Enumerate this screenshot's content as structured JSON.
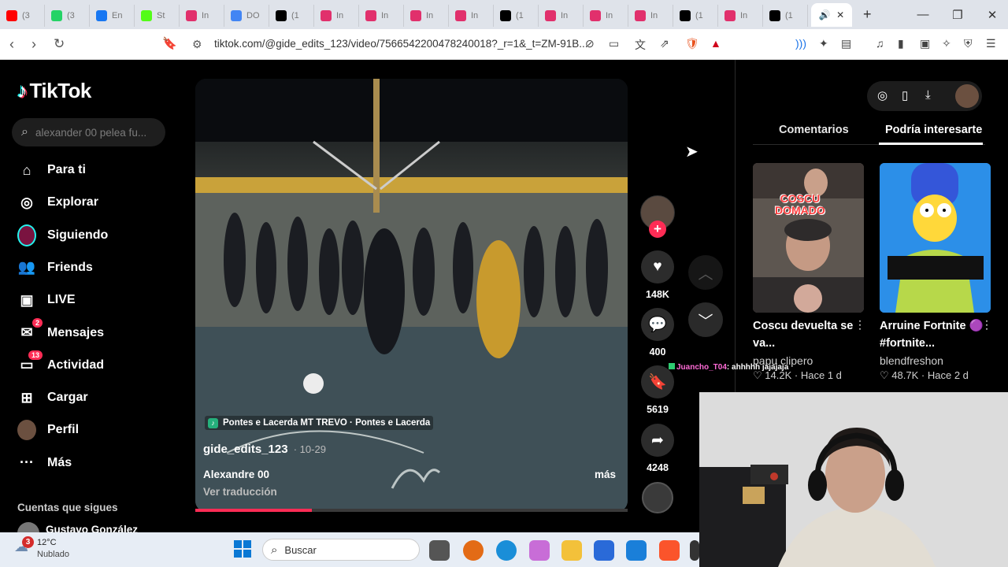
{
  "browser": {
    "tabs": [
      {
        "label": "(3",
        "favicon": "youtube-icon",
        "color": "#ff0000"
      },
      {
        "label": "(3",
        "favicon": "whatsapp-icon",
        "color": "#25d366"
      },
      {
        "label": "En",
        "favicon": "facebook-icon",
        "color": "#1877f2"
      },
      {
        "label": "St",
        "favicon": "kick-icon",
        "color": "#53fc18"
      },
      {
        "label": "In",
        "favicon": "instagram-icon",
        "color": "#e1306c"
      },
      {
        "label": "DO",
        "favicon": "google-icon",
        "color": "#4285f4"
      },
      {
        "label": "(1",
        "favicon": "tiktok-icon",
        "color": "#000000"
      },
      {
        "label": "In",
        "favicon": "instagram-icon",
        "color": "#e1306c"
      },
      {
        "label": "In",
        "favicon": "instagram-icon",
        "color": "#e1306c"
      },
      {
        "label": "In",
        "favicon": "instagram-icon",
        "color": "#e1306c"
      },
      {
        "label": "In",
        "favicon": "instagram-icon",
        "color": "#e1306c"
      },
      {
        "label": "(1",
        "favicon": "tiktok-icon",
        "color": "#000000"
      },
      {
        "label": "In",
        "favicon": "instagram-icon",
        "color": "#e1306c"
      },
      {
        "label": "In",
        "favicon": "instagram-icon",
        "color": "#e1306c"
      },
      {
        "label": "In",
        "favicon": "instagram-icon",
        "color": "#e1306c"
      },
      {
        "label": "(1",
        "favicon": "tiktok-icon",
        "color": "#000000"
      },
      {
        "label": "In",
        "favicon": "instagram-icon",
        "color": "#e1306c"
      },
      {
        "label": "(1",
        "favicon": "tiktok-icon",
        "color": "#000000"
      }
    ],
    "url": "tiktok.com/@gide_edits_123/video/7566542200478240018?_r=1&_t=ZM-91B..."
  },
  "sidebar": {
    "logo": "TikTok",
    "search_placeholder": "alexander 00 pelea fu...",
    "items": [
      {
        "label": "Para ti",
        "icon": "home-icon"
      },
      {
        "label": "Explorar",
        "icon": "compass-icon"
      },
      {
        "label": "Siguiendo",
        "icon": "following-avatar-icon"
      },
      {
        "label": "Friends",
        "icon": "friends-icon"
      },
      {
        "label": "LIVE",
        "icon": "live-icon"
      },
      {
        "label": "Mensajes",
        "icon": "message-icon",
        "badge": "2"
      },
      {
        "label": "Actividad",
        "icon": "activity-icon",
        "badge": "13"
      },
      {
        "label": "Cargar",
        "icon": "upload-icon"
      },
      {
        "label": "Perfil",
        "icon": "profile-avatar-icon"
      },
      {
        "label": "Más",
        "icon": "more-icon"
      }
    ],
    "following_heading": "Cuentas que sigues",
    "following_first": "Gustavo González"
  },
  "video": {
    "music_label": "Pontes e Lacerda MT TREVO · Pontes e Lacerda",
    "username": "gide_edits_123",
    "date": "· 10-29",
    "caption": "Alexandre 00",
    "more": "más",
    "translate": "Ver traducción",
    "progress": 0.27
  },
  "actions": {
    "likes": "148K",
    "comments": "400",
    "saves": "5619",
    "shares": "4248"
  },
  "chat_overlay": {
    "user": "Juancho_T04",
    "message": ": ahhhhh jajajaja"
  },
  "right_panel": {
    "tabs": [
      "Comentarios",
      "Podría interesarte"
    ],
    "active_tab": "Podría interesarte",
    "cards": [
      {
        "overlay": "COSCU\nDOMADO",
        "title": "Coscu devuelta se va...",
        "user": "papu clipero",
        "likes": "14.2K",
        "age": "Hace 1 d"
      },
      {
        "overlay": "",
        "title": "Arruine Fortnite 🟣 #fortnite...",
        "user": "blendfreshon",
        "likes": "48.7K",
        "age": "Hace 2 d"
      }
    ]
  },
  "taskbar": {
    "weather_badge": "3",
    "temp": "12°C",
    "condition": "Nublado",
    "search": "Buscar"
  }
}
